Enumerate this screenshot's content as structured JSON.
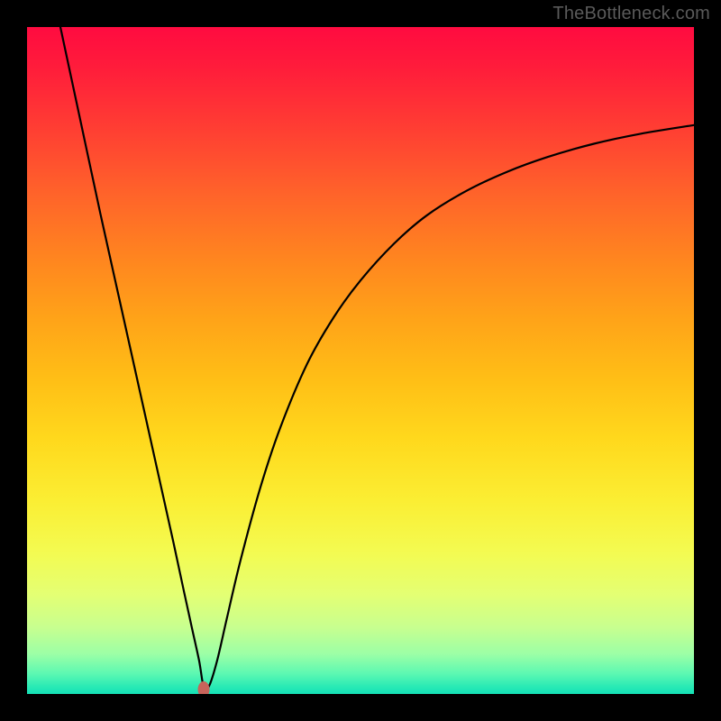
{
  "watermark": "TheBottleneck.com",
  "marker": {
    "x_pct": 26.5,
    "y_pct": 99.3
  },
  "colors": {
    "frame": "#000000",
    "curve": "#000000",
    "marker": "#c7645b",
    "gradient_top": "#ff0b40",
    "gradient_bottom": "#14e2b7"
  },
  "chart_data": {
    "type": "line",
    "title": "",
    "xlabel": "",
    "ylabel": "",
    "xlim": [
      0,
      100
    ],
    "ylim": [
      0,
      100
    ],
    "grid": false,
    "legend": false,
    "note": "Axes have no visible tick labels; values are percentage-of-plot coordinates (0 at left/bottom, 100 at right/top). Curve read from pixel positions.",
    "series": [
      {
        "name": "bottleneck-curve",
        "x": [
          5.0,
          8.0,
          11.0,
          14.0,
          17.0,
          20.0,
          22.0,
          23.5,
          24.7,
          25.8,
          26.5,
          27.3,
          28.5,
          30.0,
          32.0,
          35.0,
          38.0,
          42.0,
          46.0,
          50.0,
          55.0,
          60.0,
          66.0,
          72.0,
          78.0,
          85.0,
          92.0,
          100.0
        ],
        "y": [
          100.0,
          86.0,
          72.0,
          58.5,
          45.0,
          31.5,
          22.5,
          15.5,
          10.0,
          5.0,
          1.0,
          1.2,
          5.0,
          11.5,
          20.0,
          31.0,
          40.0,
          49.5,
          56.5,
          62.0,
          67.5,
          71.8,
          75.5,
          78.3,
          80.5,
          82.5,
          84.0,
          85.3
        ]
      }
    ],
    "markers": [
      {
        "name": "optimum-point",
        "x": 26.5,
        "y": 0.7
      }
    ]
  }
}
